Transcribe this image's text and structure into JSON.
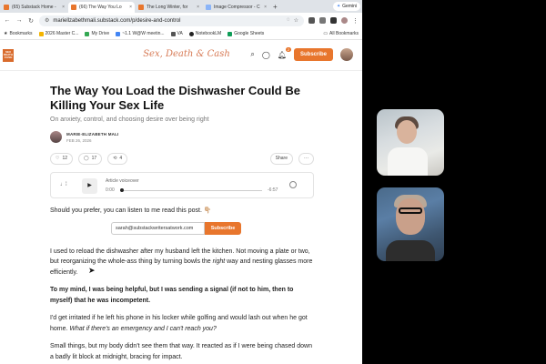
{
  "browser": {
    "tabs": [
      {
        "label": "(65) Substack Home -",
        "color": "#e8762d",
        "active": false
      },
      {
        "label": "(66) The Way You Lo",
        "color": "#e8762d",
        "active": true
      },
      {
        "label": "The Long Winter, for",
        "color": "#e8762d",
        "active": false
      },
      {
        "label": "Image Compressor - C",
        "color": "#8ab4f8",
        "active": false
      }
    ],
    "new_tab": "+",
    "gemini_label": "Gemini",
    "url": "mariellzabethmali.substack.com/p/desire-and-control",
    "bookmarks": [
      {
        "label": "Bookmarks",
        "color": "#555"
      },
      {
        "label": "2026 Master C...",
        "color": "#f4b400"
      },
      {
        "label": "My Drive",
        "color": "#34a853"
      },
      {
        "label": "~1.1 W@W meetin...",
        "color": "#4285f4"
      },
      {
        "label": "VA",
        "color": "#555"
      },
      {
        "label": "NotebookLM",
        "color": "#222"
      },
      {
        "label": "Google Sheets",
        "color": "#0f9d58"
      }
    ],
    "all_bookmarks": "All Bookmarks"
  },
  "site": {
    "logo_text": "SEX DEATH CASH",
    "brand": "Sex, Death & Cash",
    "notif_count": "2",
    "subscribe_label": "Subscribe"
  },
  "article": {
    "title": "The Way You Load the Dishwasher Could Be Killing Your Sex Life",
    "subtitle": "On anxiety, control, and choosing desire over being right",
    "author": "MARIE-ELIZABETH MALI",
    "date": "FEB 26, 2026",
    "likes": "12",
    "comments": "17",
    "restacks": "4",
    "share_label": "Share",
    "more_label": "···",
    "player": {
      "label": "Article voiceover",
      "current": "0:00",
      "remaining": "-6:57",
      "progress": 0
    },
    "listen_text": "Should you prefer, you can listen to me read this post. 👇🏼",
    "email_value": "sarah@substackwritersatwork.com",
    "subscribe_btn": "Subscribe",
    "paragraphs": [
      {
        "text": "I used to reload the dishwasher after my husband left the kitchen. Not moving a plate or two, but reorganizing the whole-ass thing by turning bowls the right way and nesting glasses more efficiently.",
        "bold": false
      },
      {
        "text": "To my mind, I was being helpful, but I was sending a signal (if not to him, then to myself) that he was incompetent.",
        "bold": true
      },
      {
        "text": "I'd get irritated if he left his phone in his locker while golfing and would lash out when he got home. What if there's an emergency and I can't reach you?",
        "bold": false
      },
      {
        "text": "Small things, but my body didn't see them that way. It reacted as if I were being chased down a badly lit block at midnight, bracing for impact.",
        "bold": false
      }
    ]
  }
}
